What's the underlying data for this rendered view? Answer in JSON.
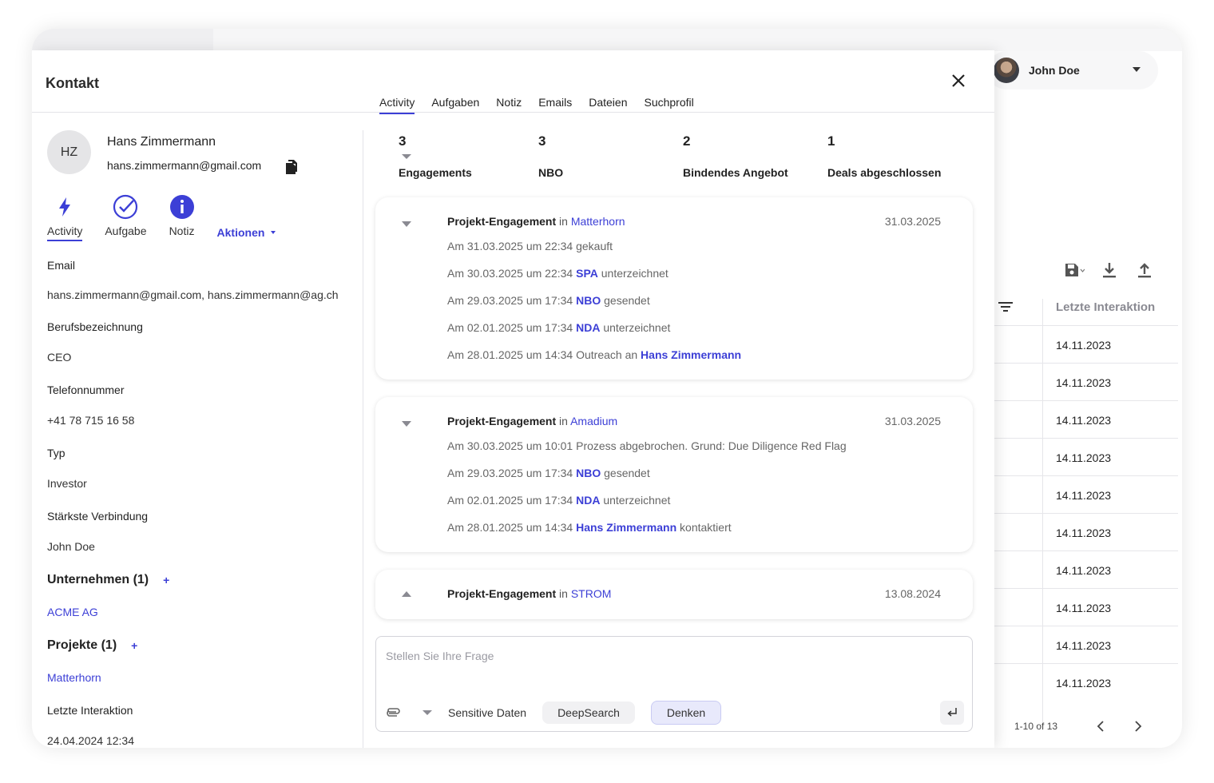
{
  "modal": {
    "title": "Kontakt",
    "tabs": [
      {
        "label": "Activity",
        "active": true
      },
      {
        "label": "Aufgaben",
        "active": false
      },
      {
        "label": "Notiz",
        "active": false
      },
      {
        "label": "Emails",
        "active": false
      },
      {
        "label": "Dateien",
        "active": false
      },
      {
        "label": "Suchprofil",
        "active": false
      }
    ]
  },
  "contact": {
    "initials": "HZ",
    "name": "Hans Zimmermann",
    "email": "hans.zimmermann@gmail.com",
    "quick_actions": [
      {
        "label": "Activity",
        "icon": "bolt-icon",
        "active": true
      },
      {
        "label": "Aufgabe",
        "icon": "check-circle-icon",
        "active": false
      },
      {
        "label": "Notiz",
        "icon": "info-icon",
        "active": false
      }
    ],
    "aktionen_label": "Aktionen",
    "fields": [
      {
        "label": "Email",
        "value": "hans.zimmermann@gmail.com, hans.zimmermann@ag.ch"
      },
      {
        "label": "Berufsbezeichnung",
        "value": "CEO"
      },
      {
        "label": "Telefonnummer",
        "value": "+41 78 715 16 58"
      },
      {
        "label": "Typ",
        "value": "Investor"
      },
      {
        "label": "Stärkste Verbindung",
        "value": "John Doe"
      }
    ],
    "companies": {
      "heading": "Unternehmen (1)",
      "plus": "+",
      "items": [
        "ACME AG"
      ]
    },
    "projects": {
      "heading": "Projekte (1)",
      "plus": "+",
      "items": [
        "Matterhorn"
      ]
    },
    "last_interaction": {
      "label": "Letzte Interaktion",
      "value": "24.04.2024 12:34"
    }
  },
  "stats": [
    {
      "value": "3",
      "label": "Engagements"
    },
    {
      "value": "3",
      "label": "NBO"
    },
    {
      "value": "2",
      "label": "Bindendes Angebot"
    },
    {
      "value": "1",
      "label": "Deals abgeschlossen"
    }
  ],
  "engagements": [
    {
      "title": "Projekt-Engagement",
      "in": "in",
      "project": "Matterhorn",
      "date": "31.03.2025",
      "expanded": true,
      "events": [
        {
          "pre": "Am 31.03.2025 um 22:34 gekauft",
          "hl": "",
          "post": ""
        },
        {
          "pre": "Am 30.03.2025 um 22:34 ",
          "hl": "SPA",
          "post": " unterzeichnet"
        },
        {
          "pre": "Am 29.03.2025 um 17:34 ",
          "hl": "NBO",
          "post": " gesendet"
        },
        {
          "pre": "Am 02.01.2025 um 17:34 ",
          "hl": "NDA",
          "post": " unterzeichnet"
        },
        {
          "pre": "Am 28.01.2025 um 14:34 Outreach an ",
          "hl": "Hans Zimmermann",
          "post": ""
        }
      ]
    },
    {
      "title": "Projekt-Engagement",
      "in": "in",
      "project": "Amadium",
      "date": "31.03.2025",
      "expanded": true,
      "events": [
        {
          "pre": "Am 30.03.2025 um 10:01 Prozess abgebrochen. Grund: Due Diligence Red Flag",
          "hl": "",
          "post": ""
        },
        {
          "pre": "Am 29.03.2025 um 17:34 ",
          "hl": "NBO",
          "post": " gesendet"
        },
        {
          "pre": "Am 02.01.2025 um 17:34 ",
          "hl": "NDA",
          "post": " unterzeichnet"
        },
        {
          "pre": "Am 28.01.2025 um 14:34 ",
          "hl": "Hans Zimmermann",
          "post": " kontaktiert"
        }
      ]
    },
    {
      "title": "Projekt-Engagement",
      "in": "in",
      "project": "STROM",
      "date": "13.08.2024",
      "expanded": false,
      "events": []
    }
  ],
  "chat": {
    "placeholder": "Stellen Sie Ihre Frage",
    "sensitive_label": "Sensitive Daten",
    "chips": [
      {
        "label": "DeepSearch",
        "active": false
      },
      {
        "label": "Denken",
        "active": true
      }
    ]
  },
  "background": {
    "user_name": "John Doe",
    "column_header": "Letzte Interaktion",
    "rows": [
      "14.11.2023",
      "14.11.2023",
      "14.11.2023",
      "14.11.2023",
      "14.11.2023",
      "14.11.2023",
      "14.11.2023",
      "14.11.2023",
      "14.11.2023",
      "14.11.2023"
    ],
    "pagination": "1-10 of 13"
  },
  "colors": {
    "accent": "#3c3fd6",
    "muted": "#666666"
  }
}
